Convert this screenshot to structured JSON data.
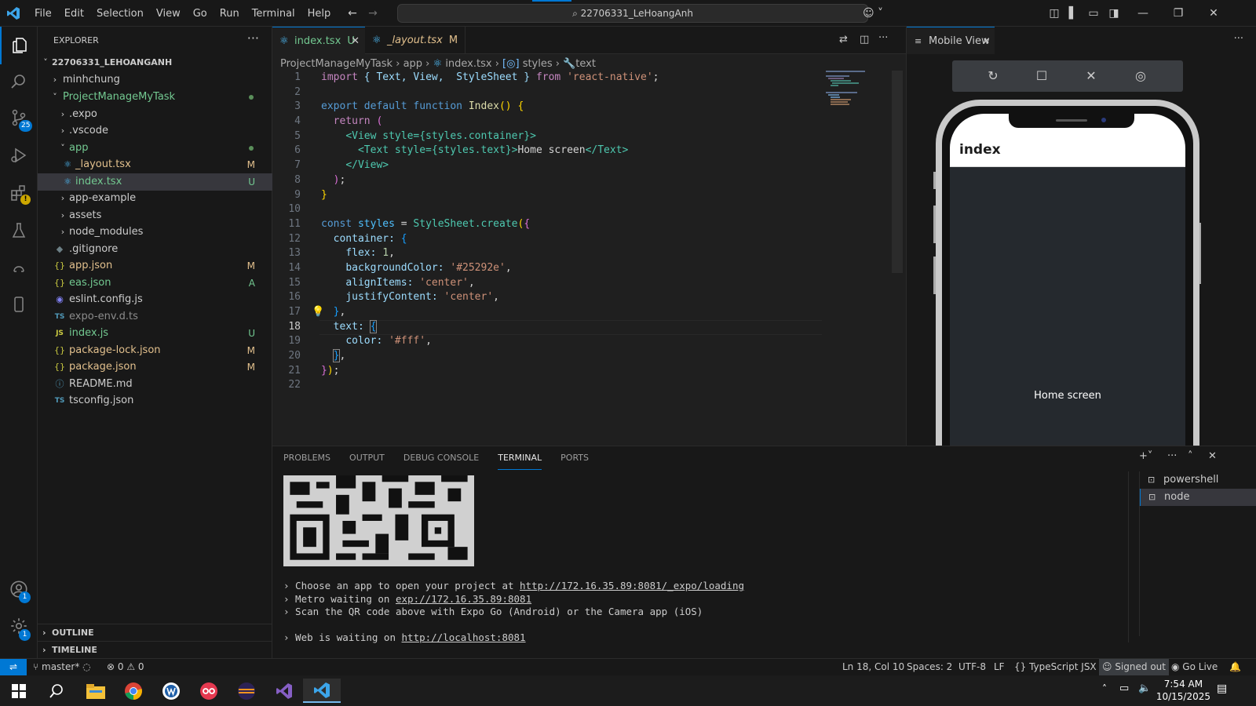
{
  "titlebar": {
    "menu": [
      "File",
      "Edit",
      "Selection",
      "View",
      "Go",
      "Run",
      "Terminal",
      "Help"
    ],
    "search": "22706331_LeHoangAnh"
  },
  "activity_badges": {
    "source_control": "25",
    "accounts": "1",
    "settings": "1"
  },
  "explorer": {
    "title": "EXPLORER",
    "root": "22706331_LEHOANGANH",
    "items": [
      {
        "label": "minhchung",
        "status": ""
      },
      {
        "label": "ProjectManageMyTask",
        "status": ""
      },
      {
        "label": ".expo",
        "status": ""
      },
      {
        "label": ".vscode",
        "status": ""
      },
      {
        "label": "app",
        "status": ""
      },
      {
        "label": "_layout.tsx",
        "status": "M"
      },
      {
        "label": "index.tsx",
        "status": "U"
      },
      {
        "label": "app-example",
        "status": ""
      },
      {
        "label": "assets",
        "status": ""
      },
      {
        "label": "node_modules",
        "status": ""
      },
      {
        "label": ".gitignore",
        "status": ""
      },
      {
        "label": "app.json",
        "status": "M"
      },
      {
        "label": "eas.json",
        "status": "A"
      },
      {
        "label": "eslint.config.js",
        "status": ""
      },
      {
        "label": "expo-env.d.ts",
        "status": ""
      },
      {
        "label": "index.js",
        "status": "U"
      },
      {
        "label": "package-lock.json",
        "status": "M"
      },
      {
        "label": "package.json",
        "status": "M"
      },
      {
        "label": "README.md",
        "status": ""
      },
      {
        "label": "tsconfig.json",
        "status": ""
      }
    ],
    "outline": "OUTLINE",
    "timeline": "TIMELINE"
  },
  "editor": {
    "tabs": [
      {
        "label": "index.tsx",
        "status": "U"
      },
      {
        "label": "_layout.tsx",
        "status": "M"
      }
    ],
    "breadcrumb": [
      "ProjectManageMyTask",
      "app",
      "index.tsx",
      "styles",
      "text"
    ],
    "line_numbers": [
      "1",
      "2",
      "3",
      "4",
      "5",
      "6",
      "7",
      "8",
      "9",
      "10",
      "11",
      "12",
      "13",
      "14",
      "15",
      "16",
      "17",
      "18",
      "19",
      "20",
      "21",
      "22"
    ],
    "code": {
      "l1_import": "import",
      "l1_mid": "{ Text, View,  StyleSheet }",
      "l1_from": "from",
      "l1_str": "'react-native'",
      "l3_export": "export default function",
      "l3_name": "Index",
      "l4_return": "return",
      "l5_open": "<View style={styles.container}>",
      "l6_open": "<Text style={styles.text}>",
      "l6_text": "Home screen",
      "l6_close": "</Text>",
      "l7_close": "</View>",
      "l11_const": "const",
      "l11_name": "styles",
      "l11_call": "StyleSheet.create",
      "l12": "container:",
      "l13_key": "flex:",
      "l13_val": "1",
      "l14_key": "backgroundColor:",
      "l14_val": "'#25292e'",
      "l15_key": "alignItems:",
      "l15_val": "'center'",
      "l16_key": "justifyContent:",
      "l16_val": "'center'",
      "l18": "text:",
      "l19_key": "color:",
      "l19_val": "'#fff'"
    }
  },
  "mobile_view": {
    "tab_label": "Mobile View",
    "screen_title": "index",
    "screen_text": "Home screen"
  },
  "panel": {
    "tabs": [
      "PROBLEMS",
      "OUTPUT",
      "DEBUG CONSOLE",
      "TERMINAL",
      "PORTS"
    ],
    "lines": [
      {
        "prefix": "› Choose an app to open your project at ",
        "link": "http://172.16.35.89:8081/_expo/loading"
      },
      {
        "prefix": "› Metro waiting on ",
        "link": "exp://172.16.35.89:8081"
      },
      {
        "prefix": "› Scan the QR code above with Expo Go (Android) or the Camera app (iOS)",
        "link": ""
      },
      {
        "prefix": "",
        "link": ""
      },
      {
        "prefix": "› Web is waiting on ",
        "link": "http://localhost:8081"
      }
    ],
    "terminals": [
      "powershell",
      "node"
    ]
  },
  "statusbar": {
    "branch": "master*",
    "problems": "0",
    "warnings": "0",
    "position": "Ln 18, Col 10",
    "spaces": "Spaces: 2",
    "encoding": "UTF-8",
    "eol": "LF",
    "language": "TypeScript JSX",
    "account": "Signed out",
    "golive": "Go Live"
  },
  "taskbar": {
    "time": "7:54 AM",
    "date": "10/15/2025"
  },
  "colors": {
    "accent": "#0078d4",
    "modified": "#e2c08d",
    "untracked": "#73c991"
  }
}
